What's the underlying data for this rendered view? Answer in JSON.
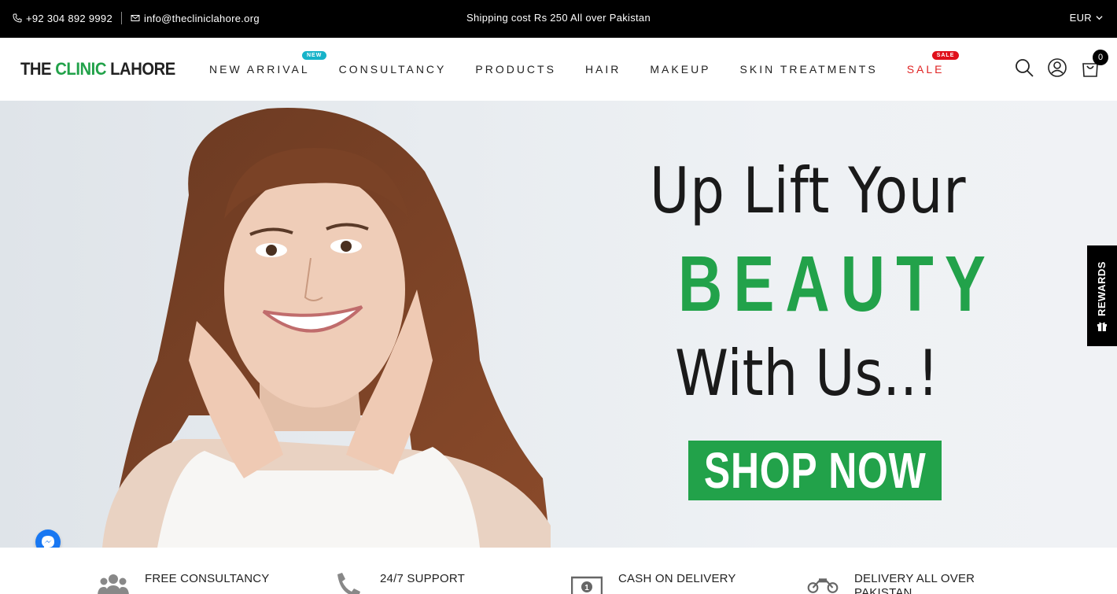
{
  "topbar": {
    "phone": "+92 304 892 9992",
    "email": "info@thecliniclahore.org",
    "announcement": "Shipping cost Rs 250 All over Pakistan",
    "currency": "EUR"
  },
  "header": {
    "logo_part1": "THE ",
    "logo_part2": "CLINIC",
    "logo_part3": " LAHORE",
    "nav": [
      {
        "label": "NEW ARRIVAL",
        "badge": "NEW"
      },
      {
        "label": "CONSULTANCY"
      },
      {
        "label": "PRODUCTS"
      },
      {
        "label": "HAIR"
      },
      {
        "label": "MAKEUP"
      },
      {
        "label": "SKIN TREATMENTS"
      },
      {
        "label": "SALE",
        "badge": "SALE"
      }
    ],
    "cart_count": "0",
    "icons": [
      "search-icon",
      "account-icon",
      "cart-icon"
    ]
  },
  "hero": {
    "line1": "Up Lift Your",
    "line2": "BEAUTY",
    "line3": "With Us..!",
    "cta": "SHOP NOW"
  },
  "rewards": {
    "label": "REWARDS"
  },
  "features": [
    {
      "label": "FREE CONSULTANCY",
      "icon": "people-icon"
    },
    {
      "label": "24/7 SUPPORT",
      "icon": "phone-icon"
    },
    {
      "label": "CASH ON DELIVERY",
      "icon": "cash-icon"
    },
    {
      "label": "DELIVERY ALL OVER PAKISTAN",
      "icon": "motorbike-icon"
    }
  ],
  "colors": {
    "brand_green": "#22a24a",
    "sale_red": "#e02424",
    "new_badge": "#17b3c9",
    "topbar_bg": "#000000",
    "messenger_blue": "#1877f2"
  }
}
